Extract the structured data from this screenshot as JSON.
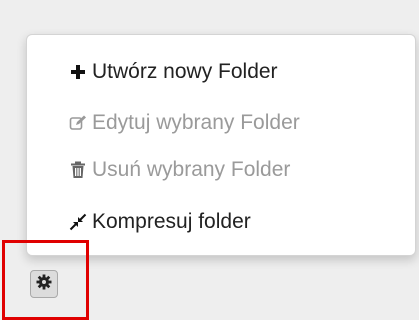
{
  "context_menu": {
    "items": [
      {
        "label": "Utwórz nowy Folder",
        "icon": "plus-icon",
        "enabled": true
      },
      {
        "label": "Edytuj wybrany Folder",
        "icon": "edit-icon",
        "enabled": false
      },
      {
        "label": "Usuń wybrany Folder",
        "icon": "trash-icon",
        "enabled": false
      },
      {
        "label": "Kompresuj folder",
        "icon": "compress-icon",
        "enabled": true
      }
    ]
  },
  "settings_button": {
    "icon": "gear-icon"
  },
  "colors": {
    "highlight": "#e00000",
    "enabled_text": "#222222",
    "disabled_text": "#9a9a9a"
  }
}
